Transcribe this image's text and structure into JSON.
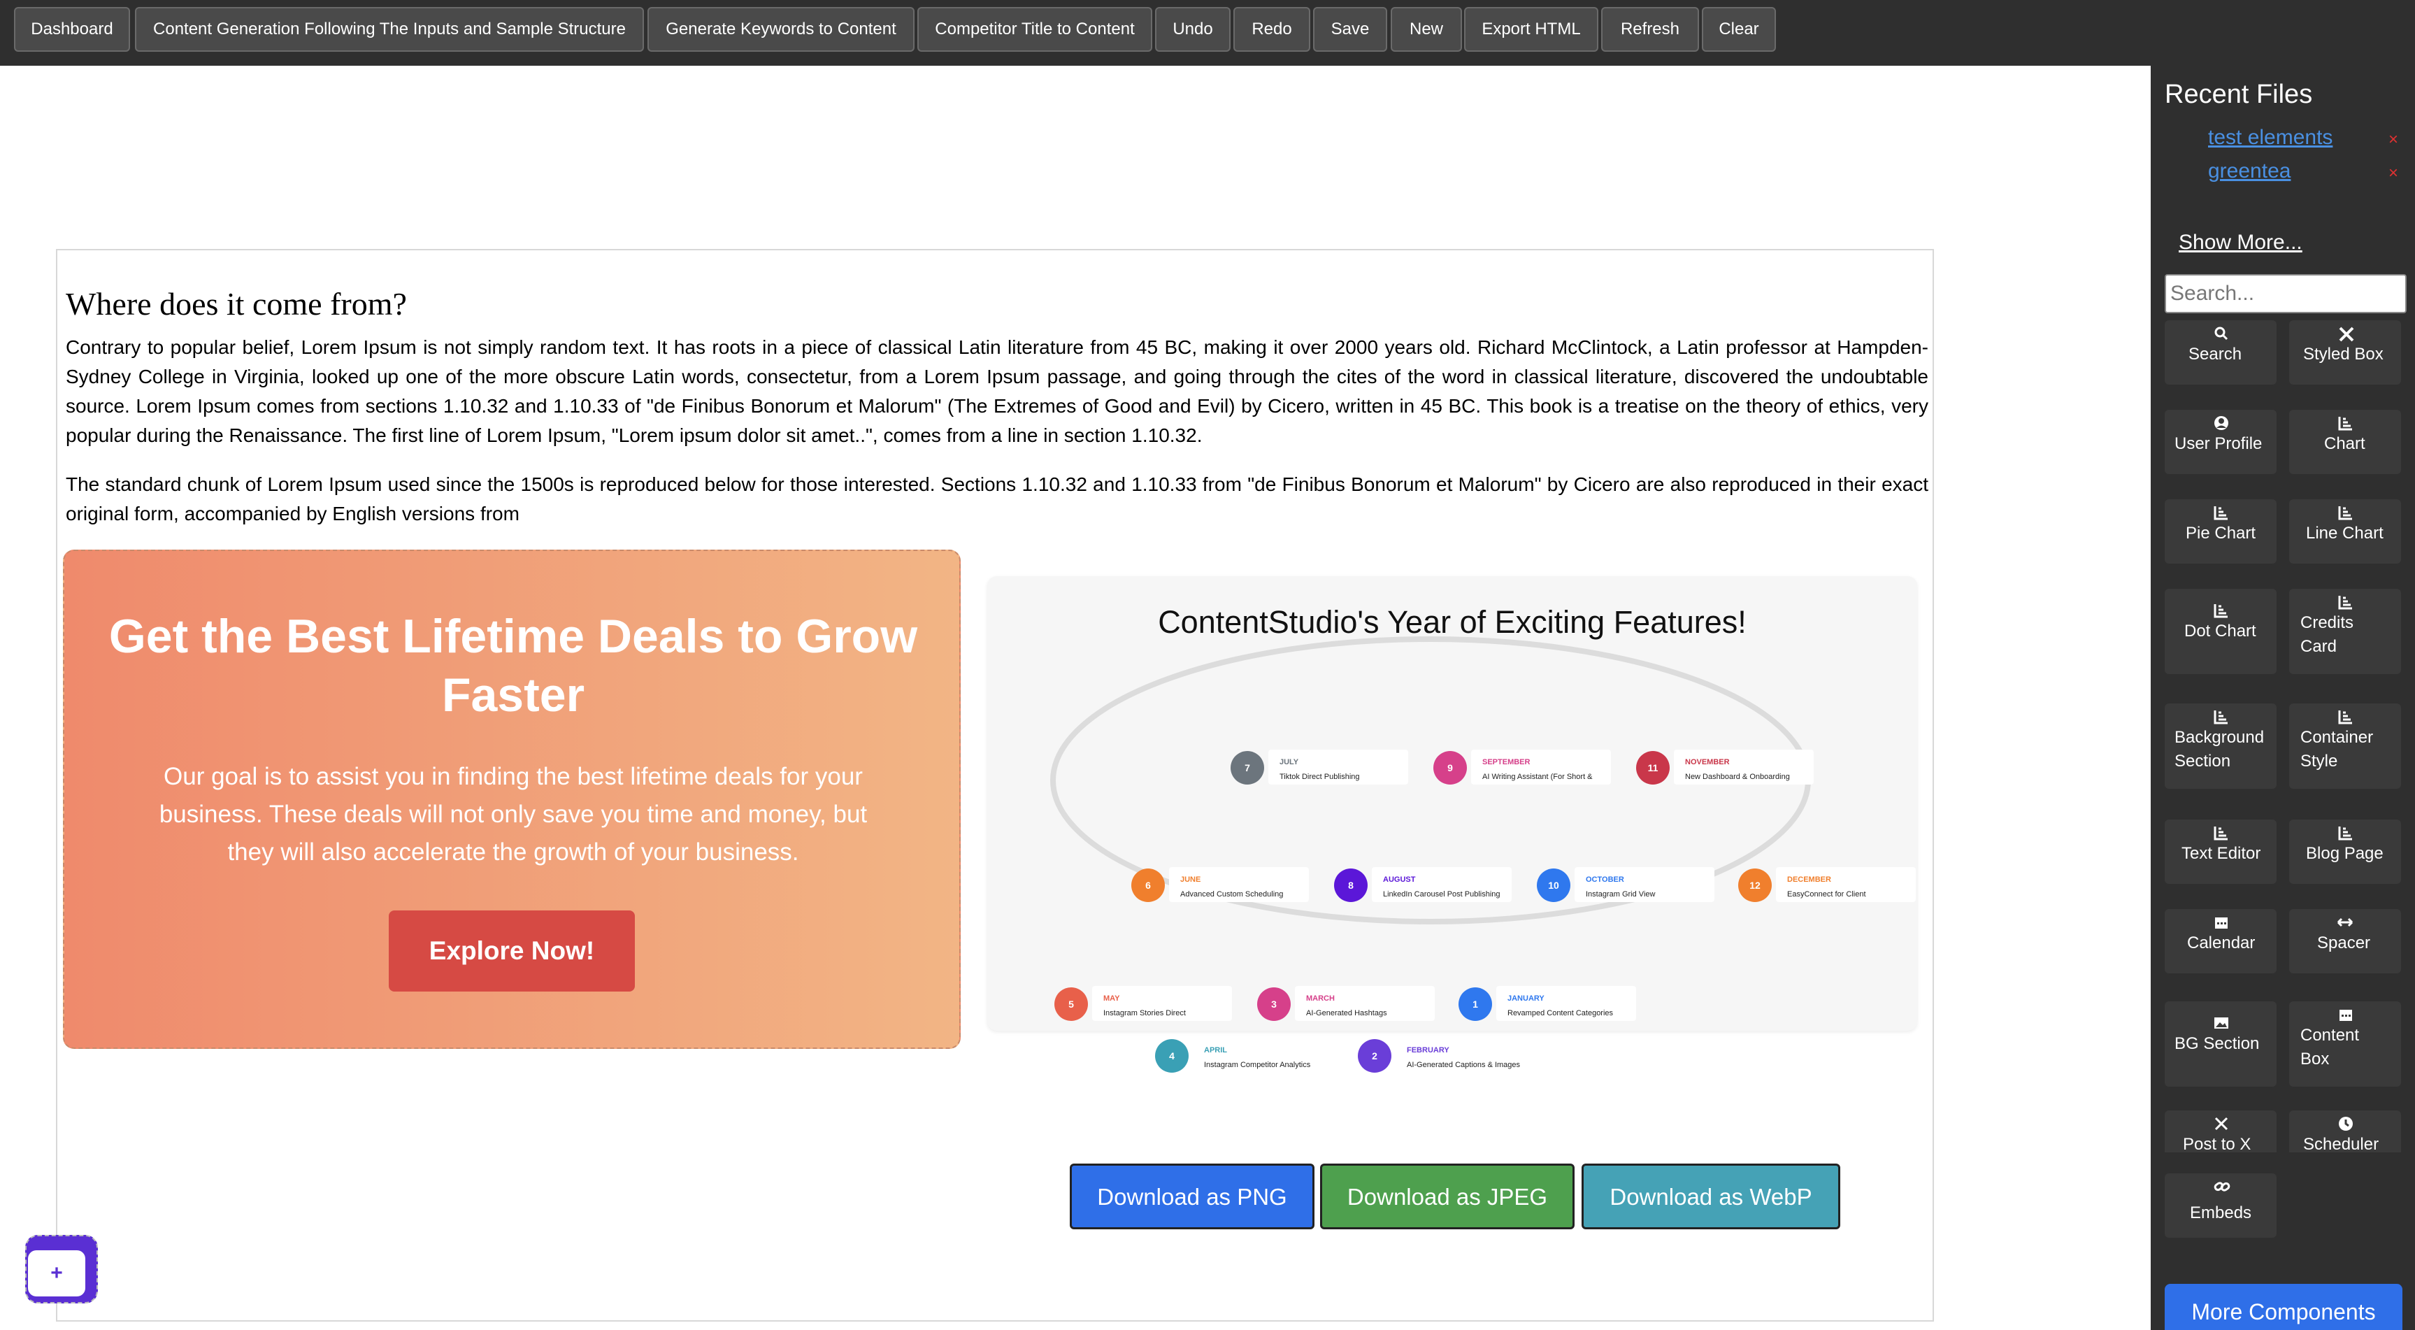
{
  "toolbar": {
    "buttons": [
      "Dashboard",
      "Content Generation Following The Inputs and Sample Structure",
      "Generate Keywords to Content",
      "Competitor Title to Content",
      "Undo",
      "Redo",
      "Save",
      "New",
      "Export HTML",
      "Refresh",
      "Clear"
    ]
  },
  "sidebar": {
    "recent_files_title": "Recent Files",
    "recent_files": [
      "test elements",
      "greentea"
    ],
    "remove_glyph": "×",
    "show_more": "Show More...",
    "search_placeholder": "Search...",
    "components": [
      {
        "label": "Search",
        "icon": "search-icon"
      },
      {
        "label": "Styled Box",
        "icon": "styled-box-icon"
      },
      {
        "label": "User Profile",
        "icon": "user-icon"
      },
      {
        "label": "Chart",
        "icon": "chart-icon"
      },
      {
        "label": "Pie Chart",
        "icon": "chart-icon"
      },
      {
        "label": "Line Chart",
        "icon": "chart-icon"
      },
      {
        "label": "Dot Chart",
        "icon": "chart-icon"
      },
      {
        "label": "Credits Card",
        "icon": "chart-icon"
      },
      {
        "label": "Background Section",
        "icon": "chart-icon"
      },
      {
        "label": "Container Style",
        "icon": "chart-icon"
      },
      {
        "label": "Text Editor",
        "icon": "chart-icon"
      },
      {
        "label": "Blog Page",
        "icon": "chart-icon"
      },
      {
        "label": "Calendar",
        "icon": "calendar-icon"
      },
      {
        "label": "Spacer",
        "icon": "spacer-icon"
      },
      {
        "label": "BG Section",
        "icon": "image-icon"
      },
      {
        "label": "Content Box",
        "icon": "calendar-icon"
      },
      {
        "label": "Post to X",
        "icon": "x-icon"
      },
      {
        "label": "Scheduler",
        "icon": "clock-icon"
      },
      {
        "label": "Embeds",
        "icon": "link-icon"
      }
    ],
    "more_components": "More Components"
  },
  "content": {
    "heading": "Where does it come from?",
    "paragraph1": "Contrary to popular belief, Lorem Ipsum is not simply random text. It has roots in a piece of classical Latin literature from 45 BC, making it over 2000 years old. Richard McClintock, a Latin professor at Hampden-Sydney College in Virginia, looked up one of the more obscure Latin words, consectetur, from a Lorem Ipsum passage, and going through the cites of the word in classical literature, discovered the undoubtable source. Lorem Ipsum comes from sections 1.10.32 and 1.10.33 of \"de Finibus Bonorum et Malorum\" (The Extremes of Good and Evil) by Cicero, written in 45 BC. This book is a treatise on the theory of ethics, very popular during the Renaissance. The first line of Lorem Ipsum, \"Lorem ipsum dolor sit amet..\", comes from a line in section 1.10.32.",
    "paragraph2": "The standard chunk of Lorem Ipsum used since the 1500s is reproduced below for those interested. Sections 1.10.32 and 1.10.33 from \"de Finibus Bonorum et Malorum\" by Cicero are also reproduced in their exact original form, accompanied by English versions from"
  },
  "promo": {
    "heading": "Get the Best Lifetime Deals to Grow Faster",
    "body": "Our goal is to assist you in finding the best lifetime deals for your business. These deals will not only save you time and money, but they will also accelerate the growth of your business.",
    "button": "Explore Now!",
    "button_color": "#d64a44"
  },
  "timeline": {
    "title": "ContentStudio's Year of Exciting Features!",
    "events": [
      {
        "num": "7",
        "month": "JULY",
        "feature": "Tiktok Direct Publishing",
        "color": "#6c757d"
      },
      {
        "num": "9",
        "month": "SEPTEMBER",
        "feature": "AI Writing Assistant (For Short &",
        "color": "#d6408a"
      },
      {
        "num": "11",
        "month": "NOVEMBER",
        "feature": "New Dashboard & Onboarding",
        "color": "#c9374a"
      },
      {
        "num": "6",
        "month": "JUNE",
        "feature": "Advanced Custom Scheduling",
        "color": "#f07f2d"
      },
      {
        "num": "8",
        "month": "AUGUST",
        "feature": "LinkedIn Carousel Post Publishing",
        "color": "#5b17d8"
      },
      {
        "num": "10",
        "month": "OCTOBER",
        "feature": "Instagram Grid View",
        "color": "#2f78ee"
      },
      {
        "num": "12",
        "month": "DECEMBER",
        "feature": "EasyConnect for Client",
        "color": "#f07f2d"
      },
      {
        "num": "5",
        "month": "MAY",
        "feature": "Instagram Stories Direct",
        "color": "#e8604a"
      },
      {
        "num": "3",
        "month": "MARCH",
        "feature": "AI-Generated Hashtags",
        "color": "#d6408a"
      },
      {
        "num": "1",
        "month": "JANUARY",
        "feature": "Revamped Content Categories",
        "color": "#2f78ee"
      },
      {
        "num": "4",
        "month": "APRIL",
        "feature": "Instagram Competitor Analytics",
        "color": "#3aa0b5"
      },
      {
        "num": "2",
        "month": "FEBRUARY",
        "feature": "AI-Generated Captions & Images",
        "color": "#6a3ed8"
      }
    ]
  },
  "downloads": [
    {
      "label": "Download as PNG",
      "color": "#2f6fe8"
    },
    {
      "label": "Download as JPEG",
      "color": "#4ea04e"
    },
    {
      "label": "Download as WebP",
      "color": "#45a2b6"
    }
  ],
  "fab": {
    "glyph": "+"
  }
}
